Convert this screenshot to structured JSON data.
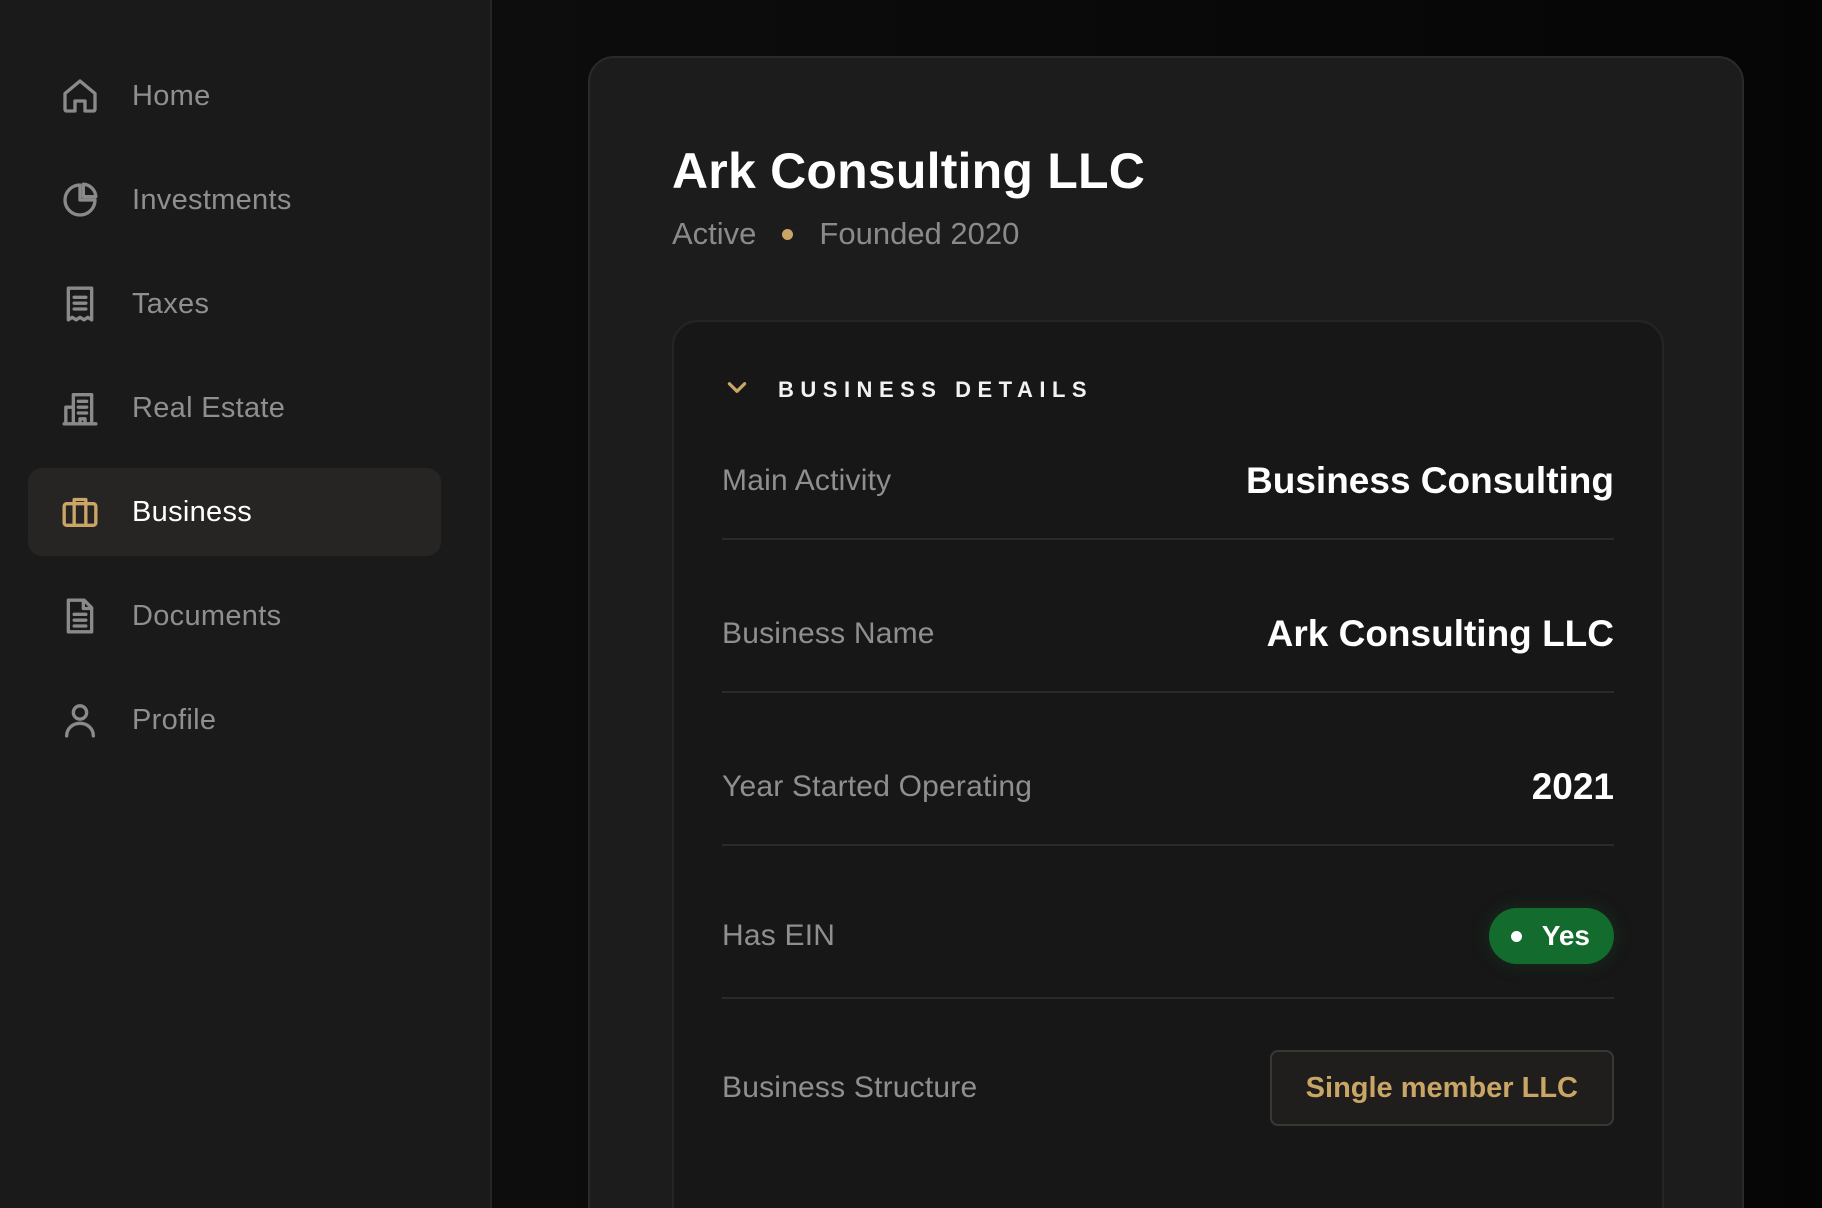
{
  "sidebar": {
    "items": [
      {
        "label": "Home",
        "icon": "home-icon"
      },
      {
        "label": "Investments",
        "icon": "pie-chart-icon"
      },
      {
        "label": "Taxes",
        "icon": "receipt-icon"
      },
      {
        "label": "Real Estate",
        "icon": "building-icon"
      },
      {
        "label": "Business",
        "icon": "briefcase-icon",
        "active": true
      },
      {
        "label": "Documents",
        "icon": "document-icon"
      },
      {
        "label": "Profile",
        "icon": "user-icon"
      }
    ]
  },
  "business": {
    "name": "Ark Consulting LLC",
    "status": "Active",
    "founded": "Founded 2020"
  },
  "details": {
    "section_title": "BUSINESS DETAILS",
    "rows": [
      {
        "label": "Main Activity",
        "value": "Business Consulting"
      },
      {
        "label": "Business Name",
        "value": "Ark Consulting LLC"
      },
      {
        "label": "Year Started Operating",
        "value": "2021"
      },
      {
        "label": "Has EIN",
        "value": "Yes"
      },
      {
        "label": "Business Structure",
        "value": "Single member LLC"
      }
    ]
  },
  "colors": {
    "accent": "#c9a566",
    "success": "#136b2e",
    "background": "#0a0a0a",
    "sidebar": "#1a1a1a"
  }
}
